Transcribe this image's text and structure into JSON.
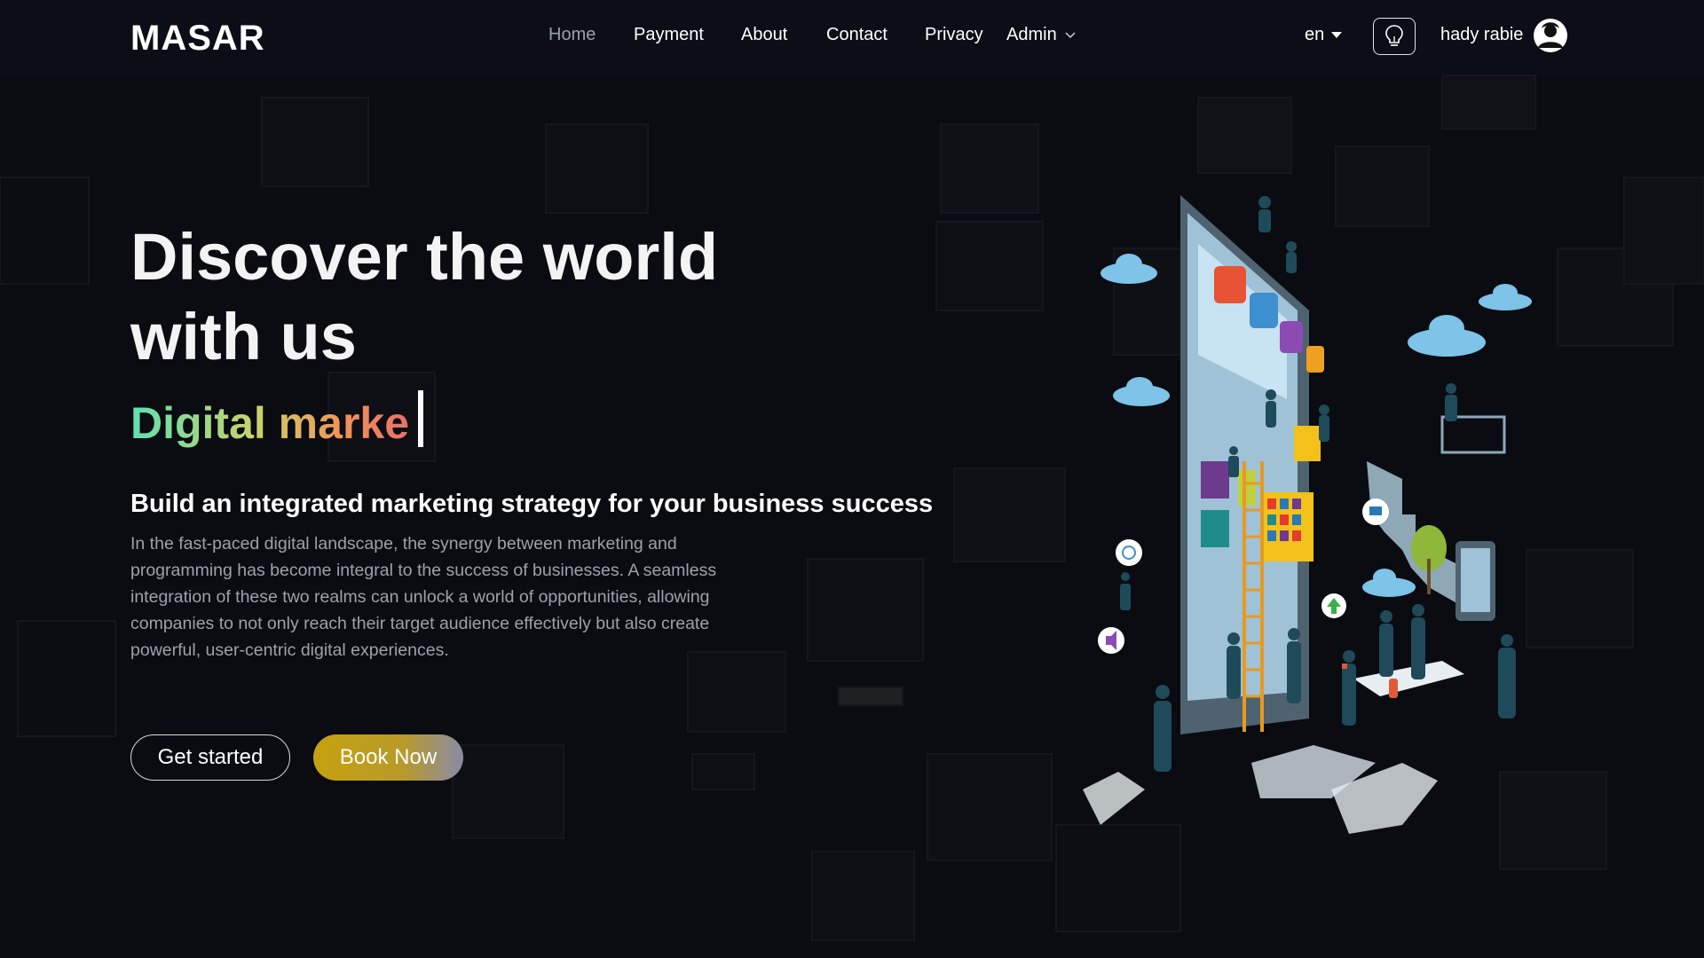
{
  "brand": {
    "logo_text": "MASAR"
  },
  "nav": {
    "items": [
      {
        "label": "Home",
        "active": true
      },
      {
        "label": "Payment"
      },
      {
        "label": "About"
      },
      {
        "label": "Contact"
      },
      {
        "label": "Privacy"
      }
    ],
    "admin_label": "Admin"
  },
  "header": {
    "language": "en",
    "user_name": "hady rabie"
  },
  "hero": {
    "title": "Discover the world with us",
    "typed_text": "Digital marke",
    "subtitle": "Build an integrated marketing strategy for your business success",
    "paragraph": "In the fast-paced digital landscape, the synergy between marketing and programming has become integral to the success of businesses. A seamless integration of these two realms can unlock a world of opportunities, allowing companies to not only reach their target audience effectively but also create powerful, user-centric digital experiences.",
    "get_started_label": "Get started",
    "book_now_label": "Book Now"
  },
  "colors": {
    "background": "#0b0d12",
    "accent_gold": "#c5a20f",
    "typed_gradient": [
      "#5fe0b2",
      "#c9d36a",
      "#f0955a",
      "#e8706a"
    ],
    "paragraph_text": "#9ea1a8"
  },
  "icons": {
    "bulb": "lightbulb-icon",
    "avatar": "user-avatar-icon",
    "caret": "caret-down-icon",
    "chevron": "chevron-down-icon"
  }
}
